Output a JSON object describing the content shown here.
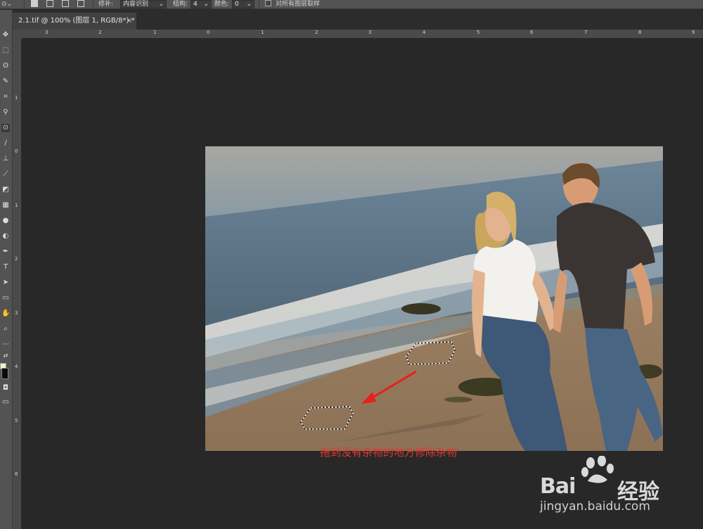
{
  "options_bar": {
    "patch_label": "修补:",
    "patch_value": "内容识别",
    "structure_label": "结构:",
    "structure_value": "4",
    "color_label": "颜色:",
    "color_value": "0",
    "sample_all_layers": "对所有图层取样"
  },
  "document_tab": {
    "title": "2.1.tif @ 100% (图层 1, RGB/8*) *",
    "close": "×"
  },
  "rulers": {
    "horizontal": [
      "3",
      "2",
      "1",
      "0",
      "1",
      "2",
      "3",
      "4",
      "5",
      "6",
      "7",
      "8",
      "9"
    ],
    "vertical": [
      "1",
      "0",
      "1",
      "2",
      "3",
      "4",
      "5",
      "6"
    ]
  },
  "photo": {
    "caption": "拖到没有杂物的地方修除杂物"
  },
  "watermark": {
    "brand": "Bai",
    "brand_suffix": "经验",
    "url": "jingyan.baidu.com"
  },
  "colors": {
    "app_bg": "#282828",
    "panel": "#535353",
    "caption_red": "#e23a2f",
    "arrow_red": "#e8201a",
    "foreground_swatch": "#f4f1c8",
    "background_swatch": "#0a0a0a"
  }
}
